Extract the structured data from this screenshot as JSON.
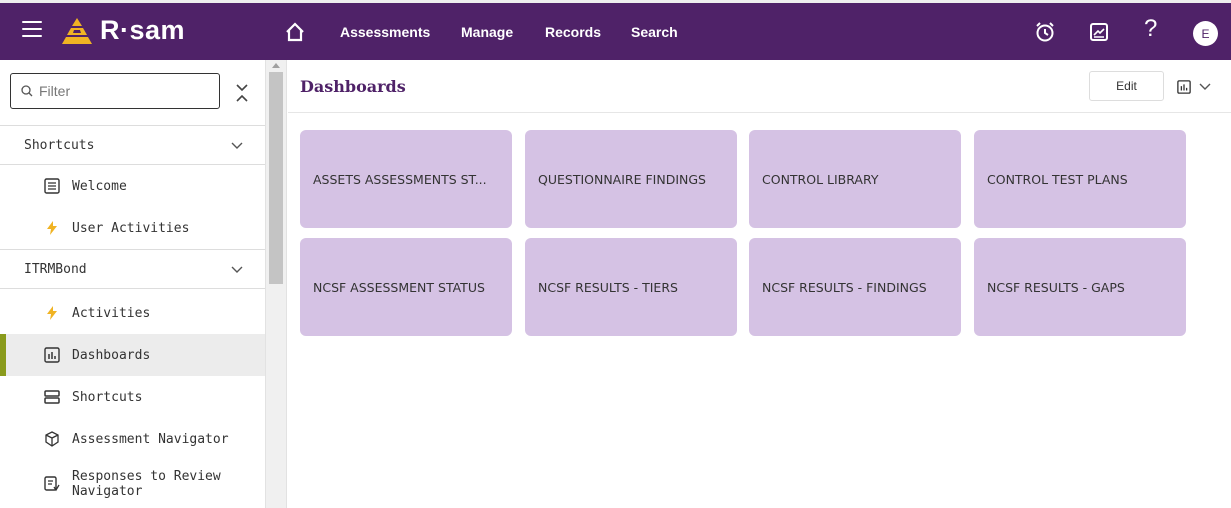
{
  "app": {
    "logo_text": "R·sam"
  },
  "topnav": {
    "items": [
      "Assessments",
      "Manage",
      "Records",
      "Search"
    ],
    "help_label": "?",
    "avatar_initial": "E"
  },
  "sidebar": {
    "filter_placeholder": "Filter",
    "sections": [
      {
        "label": "Shortcuts",
        "items": [
          {
            "label": "Welcome",
            "icon": "list-icon"
          },
          {
            "label": "User Activities",
            "icon": "lightning-icon"
          }
        ]
      },
      {
        "label": "ITRMBond",
        "items": [
          {
            "label": "Activities",
            "icon": "lightning-icon"
          },
          {
            "label": "Dashboards",
            "icon": "chart-icon",
            "active": true
          },
          {
            "label": "Shortcuts",
            "icon": "shortcuts-icon"
          },
          {
            "label": "Assessment Navigator",
            "icon": "cube-icon"
          },
          {
            "label": "Responses to Review Navigator",
            "icon": "review-icon"
          }
        ]
      }
    ]
  },
  "main": {
    "title": "Dashboards",
    "edit_label": "Edit",
    "tiles": [
      "ASSETS ASSESSMENTS ST...",
      "QUESTIONNAIRE FINDINGS",
      "CONTROL LIBRARY",
      "CONTROL TEST PLANS",
      "NCSF ASSESSMENT STATUS",
      "NCSF RESULTS - TIERS",
      "NCSF RESULTS - FINDINGS",
      "NCSF RESULTS - GAPS"
    ]
  },
  "colors": {
    "brand": "#4f2268",
    "tile": "#d5c2e4",
    "active_marker": "#8a9b1c",
    "lightning": "#f0b323"
  }
}
